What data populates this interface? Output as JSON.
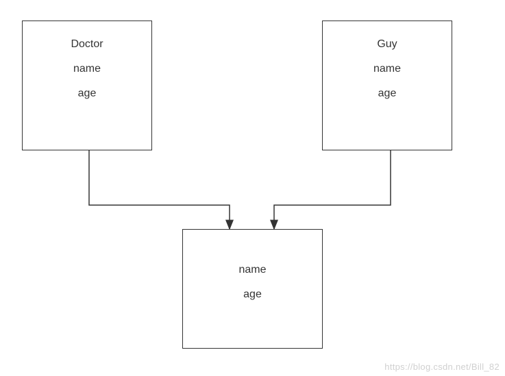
{
  "boxes": {
    "left": {
      "title": "Doctor",
      "attr1": "name",
      "attr2": "age"
    },
    "right": {
      "title": "Guy",
      "attr1": "name",
      "attr2": "age"
    },
    "bottom": {
      "attr1": "name",
      "attr2": "age"
    }
  },
  "watermark": "https://blog.csdn.net/Bill_82"
}
